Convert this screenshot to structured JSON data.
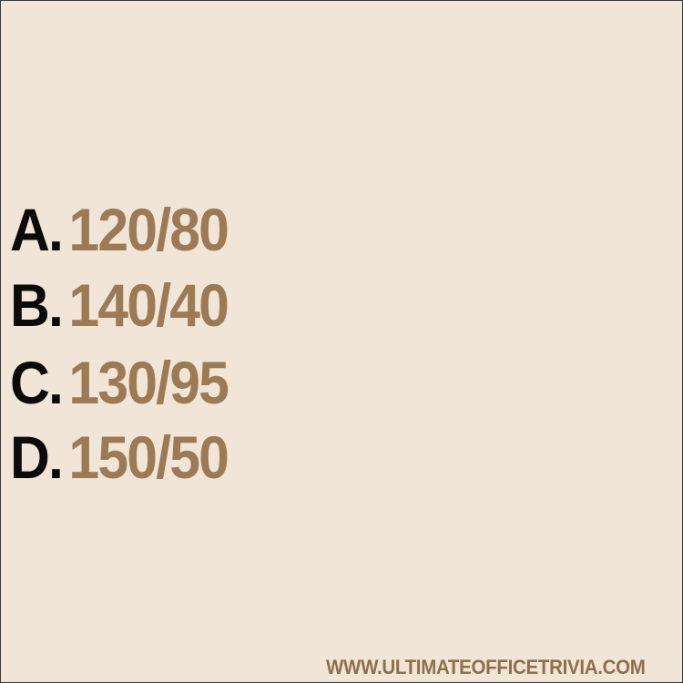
{
  "options": [
    {
      "letter": "A.",
      "value": "120/80"
    },
    {
      "letter": "B.",
      "value": "140/40"
    },
    {
      "letter": "C.",
      "value": "130/95"
    },
    {
      "letter": "D.",
      "value": "150/50"
    }
  ],
  "footer": {
    "url": "WWW.ULTIMATEOFFICETRIVIA.COM"
  },
  "colors": {
    "background": "#f0e5d6",
    "letter": "#0d0b09",
    "value": "#9b7a55"
  }
}
